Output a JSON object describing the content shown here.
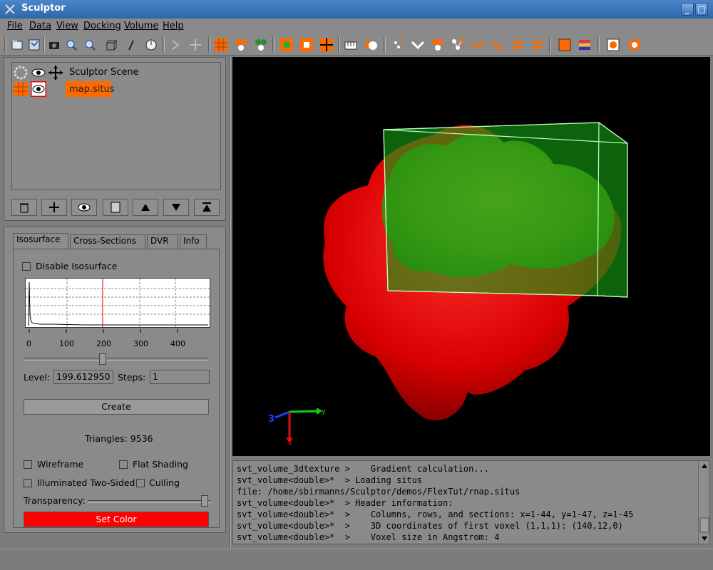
{
  "window": {
    "title": "Sculptor",
    "min_label": "_",
    "max_label": "□",
    "close_label": "×"
  },
  "menu": [
    "File",
    "Data",
    "View",
    "Docking",
    "Volume",
    "Help"
  ],
  "toolbar": {
    "icons": [
      "open-icon",
      "save-icon",
      "screenshot-icon",
      "zoom-in-icon",
      "zoom-out-icon",
      "box-icon",
      "pen-icon",
      "clock-icon",
      "sep",
      "rotate-icon",
      "move-icon",
      "sep",
      "grid-icon",
      "molecule-icon",
      "molecule-green-icon",
      "sep",
      "grid-dot-icon",
      "grid-select-icon",
      "crosshair-icon",
      "sep",
      "piano-icon",
      "pie-icon",
      "sep",
      "dots-icon",
      "check-icon",
      "tri-atom-icon",
      "tri-atom-2-icon",
      "check2-icon",
      "wave-icon",
      "swap-icon",
      "swap2-icon",
      "sep",
      "square-icon",
      "layers-icon",
      "sep",
      "gear-icon",
      "gear2-icon"
    ],
    "accent": "#ff6a00"
  },
  "scene": {
    "items": [
      {
        "label": "Sculptor Scene",
        "selected": false
      },
      {
        "label": "map.situs",
        "selected": true
      }
    ],
    "buttons": [
      "trash-icon",
      "move-icon",
      "eye-icon",
      "doc-icon",
      "up-icon",
      "down-icon",
      "top-icon"
    ]
  },
  "iso": {
    "tabs": [
      "Isosurface",
      "Cross-Sections",
      "DVR",
      "Info"
    ],
    "disable_label": "Disable Isosurface",
    "hist_ticks": [
      "0",
      "100",
      "200",
      "300",
      "400"
    ],
    "level_label": "Level:",
    "level_value": "199.612950",
    "steps_label": "Steps:",
    "steps_value": "1",
    "create_label": "Create",
    "triangles": "Triangles: 9536",
    "wireframe": "Wireframe",
    "flat_shading": "Flat Shading",
    "illum": "Illuminated Two-Sided",
    "culling": "Culling",
    "transparency": "Transparency:",
    "transparency_level": 0.98,
    "set_color": "Set Color",
    "set_color_hex": "#ff0000"
  },
  "viewport": {
    "axis_labels": {
      "x": "x",
      "y": "y",
      "z": "3"
    }
  },
  "console": {
    "lines": [
      "svt_volume_3dtexture >    Gradient calculation...",
      "svt_volume<double>*  > Loading situs",
      "file: /home/sbirmanns/Sculptor/demos/FlexTut/rnap.situs",
      "svt_volume<double>*  > Header information:",
      "svt_volume<double>*  >    Columns, rows, and sections: x=1-44, y=1-47, z=1-45",
      "svt_volume<double>*  >    3D coordinates of first voxel (1,1,1): (140,12,0)",
      "svt_volume<double>*  >    Voxel size in Angstrom: 4"
    ]
  }
}
